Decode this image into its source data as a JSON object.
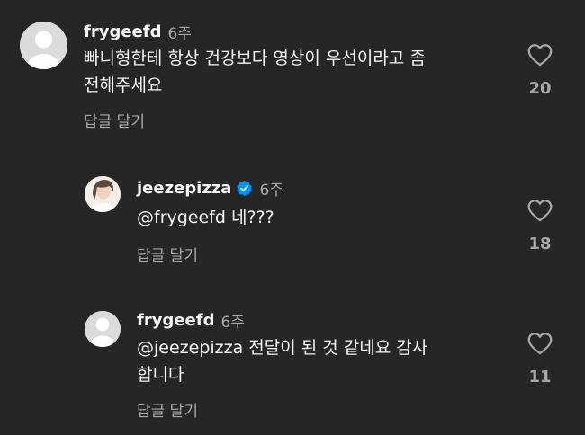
{
  "comments": [
    {
      "username": "frygeefd",
      "time": "6주",
      "text_line1": "빠니형한테 항상 건강보다 영상이 우선이라고 좀",
      "text_line2": "전해주세요",
      "reply_label": "답글 달기",
      "likes": "20",
      "verified": false
    },
    {
      "username": "jeezepizza",
      "time": "6주",
      "text_line1": "@frygeefd 네???",
      "reply_label": "답글 달기",
      "likes": "18",
      "verified": true
    },
    {
      "username": "frygeefd",
      "time": "6주",
      "text_line1": "@jeezepizza 전달이 된 것 같네요 감사",
      "text_line2": "합니다",
      "reply_label": "답글 달기",
      "likes": "11",
      "verified": false
    }
  ],
  "icons": {
    "like": "heart-outline-icon",
    "verified": "verified-badge-icon",
    "default_avatar": "default-avatar-icon"
  },
  "colors": {
    "background": "#262626",
    "text": "#f5f5f5",
    "muted": "#a8a8a8",
    "verified": "#0095f6"
  }
}
